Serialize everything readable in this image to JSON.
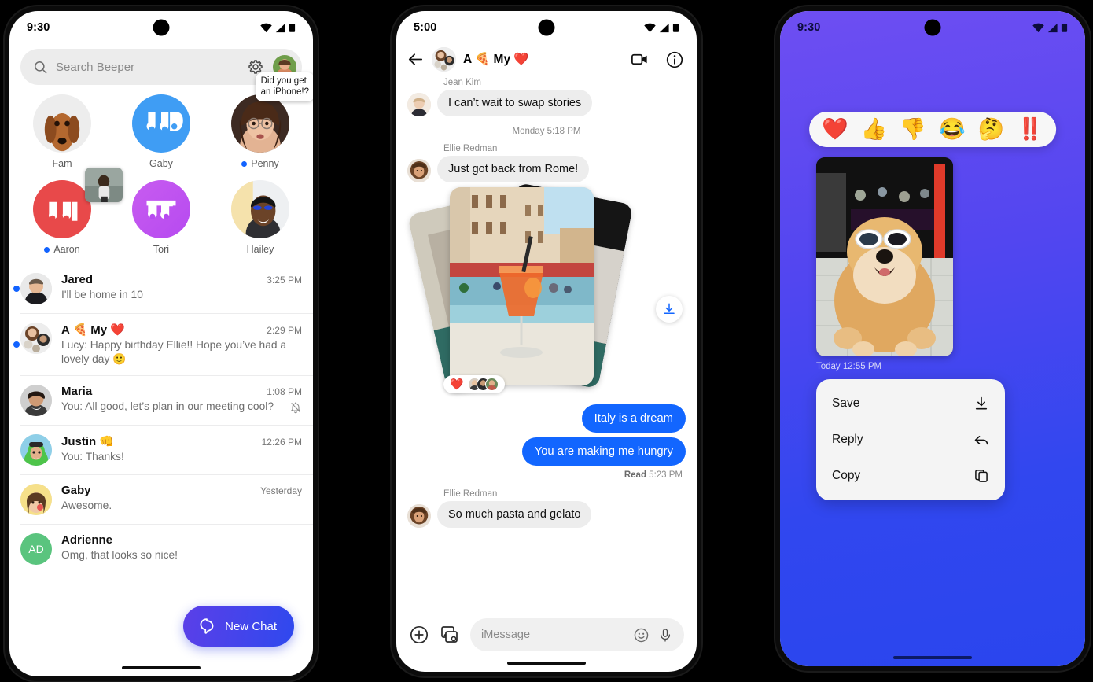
{
  "phone1": {
    "status": {
      "time": "9:30",
      "icons": [
        "wifi-icon",
        "signal-icon",
        "battery-icon"
      ]
    },
    "search": {
      "placeholder": "Search Beeper",
      "icon": "search-icon",
      "settings_icon": "gear-icon",
      "avatar": "profile-avatar"
    },
    "stories": [
      {
        "name": "Fam",
        "unread": false,
        "type": "photo-dog"
      },
      {
        "name": "Gaby",
        "unread": false,
        "type": "logo-beeper"
      },
      {
        "name": "Penny",
        "unread": true,
        "type": "photo-woman",
        "tip": "Did you get\nan iPhone!?"
      },
      {
        "name": "Aaron",
        "unread": true,
        "type": "logo-an",
        "overlay": "photo-kid"
      },
      {
        "name": "Tori",
        "unread": false,
        "type": "logo-ts"
      },
      {
        "name": "Hailey",
        "unread": false,
        "type": "photo-hailey"
      }
    ],
    "chats": [
      {
        "name": "Jared",
        "emoji": "",
        "time": "3:25 PM",
        "preview": "I'll be home in 10",
        "unread": true,
        "muted": false,
        "avatar": "photo-jared"
      },
      {
        "name": "A 🍕 My ❤️",
        "emoji": "",
        "time": "2:29 PM",
        "preview": "Lucy: Happy birthday Ellie!! Hope you’ve had a lovely day  🙂",
        "unread": true,
        "muted": false,
        "avatar": "group-avatar"
      },
      {
        "name": "Maria",
        "emoji": "",
        "time": "1:08 PM",
        "preview": "You: All good, let’s plan in our meeting cool?",
        "unread": false,
        "muted": true,
        "avatar": "photo-maria"
      },
      {
        "name": "Justin 👊",
        "emoji": "",
        "time": "12:26 PM",
        "preview": "You: Thanks!",
        "unread": false,
        "muted": false,
        "avatar": "photo-justin"
      },
      {
        "name": "Gaby",
        "emoji": "",
        "time": "Yesterday",
        "preview": "Awesome.",
        "unread": false,
        "muted": false,
        "avatar": "photo-gaby"
      },
      {
        "name": "Adrienne",
        "emoji": "",
        "time": "",
        "preview": "Omg, that looks so nice!",
        "unread": false,
        "muted": false,
        "avatar": "initials-AD",
        "initials": "AD"
      }
    ],
    "fab": {
      "label": "New Chat",
      "icon": "beeper-chat-icon",
      "color": "#3a43ed"
    }
  },
  "phone2": {
    "status": {
      "time": "5:00"
    },
    "header": {
      "back_icon": "back-arrow-icon",
      "title": "A 🍕 My ❤️",
      "video_icon": "video-camera-icon",
      "info_icon": "info-circle-icon",
      "avatar": "group-avatar"
    },
    "messages": [
      {
        "kind": "incoming",
        "sender": "Jean Kim",
        "text": "I can’t wait to swap stories",
        "avatar": "photo-jean"
      },
      {
        "kind": "daystamp",
        "text": "Monday 5:18 PM"
      },
      {
        "kind": "incoming",
        "sender": "Ellie Redman",
        "text": "Just got back from Rome!",
        "avatar": "photo-ellie"
      },
      {
        "kind": "photos",
        "reaction": "❤️",
        "download_icon": "download-icon"
      },
      {
        "kind": "outgoing",
        "text": "Italy is a dream"
      },
      {
        "kind": "outgoing",
        "text": "You are making me hungry"
      },
      {
        "kind": "readstamp",
        "label": "Read",
        "time": "5:23 PM"
      },
      {
        "kind": "incoming",
        "sender": "Ellie Redman",
        "text": "So much pasta and gelato",
        "avatar": "photo-ellie"
      }
    ],
    "composer": {
      "plus_icon": "plus-circle-icon",
      "gallery_icon": "photo-library-icon",
      "placeholder": "iMessage",
      "emoji_icon": "emoji-smiley-icon",
      "mic_icon": "microphone-icon"
    }
  },
  "phone3": {
    "status": {
      "time": "9:30"
    },
    "background": {
      "from": "#6e4ef2",
      "to": "#2a45ee"
    },
    "reactions": [
      "❤️",
      "👍",
      "👎",
      "😂",
      "🤔",
      "‼️"
    ],
    "photo": {
      "alt": "photo-dog-sunglasses"
    },
    "timestamp": "Today  12:55 PM",
    "menu": [
      {
        "label": "Save",
        "icon": "download-icon"
      },
      {
        "label": "Reply",
        "icon": "reply-arrow-icon"
      },
      {
        "label": "Copy",
        "icon": "copy-icon"
      }
    ]
  }
}
